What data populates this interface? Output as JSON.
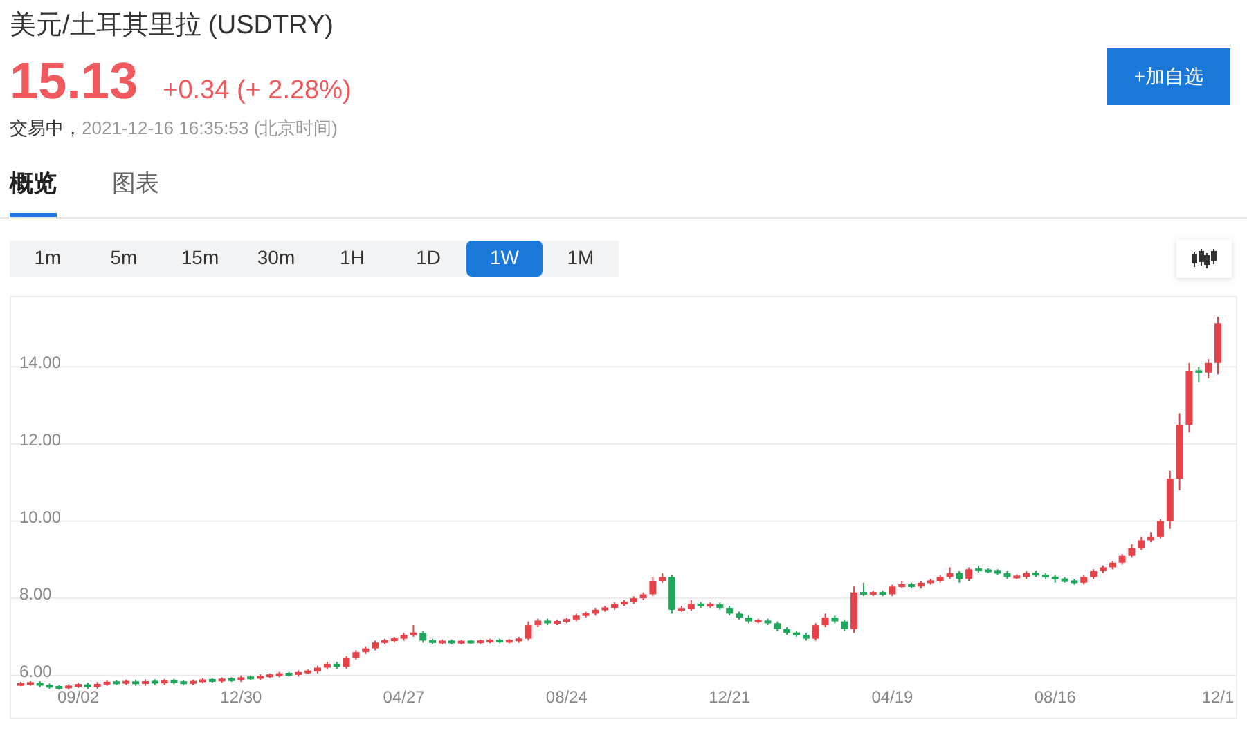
{
  "header": {
    "title": "美元/土耳其里拉 (USDTRY)",
    "price": "15.13",
    "change": "+0.34 (+ 2.28%)",
    "status": "交易中，",
    "timestamp": "2021-12-16 16:35:53 (北京时间)",
    "watch_button": "+加自选"
  },
  "tabs": [
    {
      "label": "概览",
      "selected": true
    },
    {
      "label": "图表",
      "selected": false
    }
  ],
  "intervals": [
    {
      "label": "1m",
      "selected": false
    },
    {
      "label": "5m",
      "selected": false
    },
    {
      "label": "15m",
      "selected": false
    },
    {
      "label": "30m",
      "selected": false
    },
    {
      "label": "1H",
      "selected": false
    },
    {
      "label": "1D",
      "selected": false
    },
    {
      "label": "1W",
      "selected": true
    },
    {
      "label": "1M",
      "selected": false
    }
  ],
  "chart": {
    "chart_data": {
      "type": "candlestick",
      "grid": true,
      "ylim": [
        4.9,
        15.8
      ],
      "yticks": [
        {
          "value": 6,
          "label": "6.00"
        },
        {
          "value": 8,
          "label": "8.00"
        },
        {
          "value": 10,
          "label": "10.00"
        },
        {
          "value": 12,
          "label": "12.00"
        },
        {
          "value": 14,
          "label": "14.00"
        }
      ],
      "categories": [
        null,
        null,
        null,
        null,
        null,
        null,
        "09/02",
        null,
        null,
        null,
        null,
        null,
        null,
        null,
        null,
        null,
        null,
        null,
        null,
        null,
        null,
        null,
        null,
        "12/30",
        null,
        null,
        null,
        null,
        null,
        null,
        null,
        null,
        null,
        null,
        null,
        null,
        null,
        null,
        null,
        null,
        "04/27",
        null,
        null,
        null,
        null,
        null,
        null,
        null,
        null,
        null,
        null,
        null,
        null,
        null,
        null,
        null,
        null,
        "08/24",
        null,
        null,
        null,
        null,
        null,
        null,
        null,
        null,
        null,
        null,
        null,
        null,
        null,
        null,
        null,
        null,
        "12/21",
        null,
        null,
        null,
        null,
        null,
        null,
        null,
        null,
        null,
        null,
        null,
        null,
        null,
        null,
        null,
        null,
        "04/19",
        null,
        null,
        null,
        null,
        null,
        null,
        null,
        null,
        null,
        null,
        null,
        null,
        null,
        null,
        null,
        null,
        "08/16",
        null,
        null,
        null,
        null,
        null,
        null,
        null,
        null,
        null,
        null,
        null,
        null,
        null,
        null,
        null,
        null,
        "12/1"
      ],
      "ohlc": [
        [
          5.75,
          5.83,
          5.72,
          5.78
        ],
        [
          5.78,
          5.85,
          5.73,
          5.8
        ],
        [
          5.8,
          5.85,
          5.69,
          5.74
        ],
        [
          5.74,
          5.79,
          5.65,
          5.7
        ],
        [
          5.7,
          5.75,
          5.63,
          5.68
        ],
        [
          5.68,
          5.77,
          5.63,
          5.72
        ],
        [
          5.72,
          5.81,
          5.67,
          5.76
        ],
        [
          5.76,
          5.81,
          5.65,
          5.7
        ],
        [
          5.7,
          5.83,
          5.65,
          5.78
        ],
        [
          5.78,
          5.87,
          5.73,
          5.82
        ],
        [
          5.82,
          5.87,
          5.75,
          5.8
        ],
        [
          5.8,
          5.89,
          5.75,
          5.84
        ],
        [
          5.84,
          5.89,
          5.73,
          5.78
        ],
        [
          5.78,
          5.9,
          5.73,
          5.85
        ],
        [
          5.85,
          5.9,
          5.75,
          5.8
        ],
        [
          5.8,
          5.91,
          5.75,
          5.86
        ],
        [
          5.86,
          5.91,
          5.77,
          5.82
        ],
        [
          5.82,
          5.87,
          5.75,
          5.8
        ],
        [
          5.8,
          5.89,
          5.75,
          5.84
        ],
        [
          5.84,
          5.93,
          5.79,
          5.88
        ],
        [
          5.88,
          5.93,
          5.81,
          5.86
        ],
        [
          5.86,
          5.95,
          5.81,
          5.9
        ],
        [
          5.9,
          5.95,
          5.83,
          5.88
        ],
        [
          5.88,
          6.0,
          5.83,
          5.95
        ],
        [
          5.95,
          6.0,
          5.87,
          5.92
        ],
        [
          5.92,
          6.03,
          5.87,
          5.98
        ],
        [
          5.98,
          6.05,
          5.93,
          6.0
        ],
        [
          6.0,
          6.09,
          5.95,
          6.04
        ],
        [
          6.04,
          6.09,
          5.97,
          6.02
        ],
        [
          6.02,
          6.13,
          5.97,
          6.08
        ],
        [
          6.08,
          6.15,
          6.03,
          6.1
        ],
        [
          6.1,
          6.25,
          6.05,
          6.2
        ],
        [
          6.2,
          6.35,
          6.15,
          6.3
        ],
        [
          6.3,
          6.35,
          6.17,
          6.22
        ],
        [
          6.22,
          6.5,
          6.17,
          6.45
        ],
        [
          6.45,
          6.65,
          6.4,
          6.6
        ],
        [
          6.6,
          6.75,
          6.55,
          6.7
        ],
        [
          6.7,
          6.9,
          6.65,
          6.85
        ],
        [
          6.85,
          6.95,
          6.8,
          6.9
        ],
        [
          6.9,
          7.0,
          6.85,
          6.95
        ],
        [
          6.95,
          7.1,
          6.9,
          7.05
        ],
        [
          7.05,
          7.3,
          7.0,
          7.1
        ],
        [
          7.1,
          7.15,
          6.85,
          6.9
        ],
        [
          6.9,
          6.95,
          6.8,
          6.85
        ],
        [
          6.85,
          6.93,
          6.8,
          6.88
        ],
        [
          6.88,
          6.93,
          6.8,
          6.85
        ],
        [
          6.85,
          6.92,
          6.8,
          6.87
        ],
        [
          6.87,
          6.92,
          6.81,
          6.86
        ],
        [
          6.86,
          6.93,
          6.81,
          6.88
        ],
        [
          6.88,
          6.95,
          6.83,
          6.9
        ],
        [
          6.9,
          6.95,
          6.83,
          6.88
        ],
        [
          6.88,
          6.94,
          6.83,
          6.89
        ],
        [
          6.89,
          7.0,
          6.84,
          6.95
        ],
        [
          6.95,
          7.4,
          6.9,
          7.3
        ],
        [
          7.3,
          7.47,
          7.25,
          7.42
        ],
        [
          7.42,
          7.47,
          7.3,
          7.35
        ],
        [
          7.35,
          7.45,
          7.3,
          7.4
        ],
        [
          7.4,
          7.5,
          7.35,
          7.45
        ],
        [
          7.45,
          7.6,
          7.4,
          7.55
        ],
        [
          7.55,
          7.65,
          7.5,
          7.6
        ],
        [
          7.6,
          7.75,
          7.55,
          7.7
        ],
        [
          7.7,
          7.8,
          7.65,
          7.75
        ],
        [
          7.75,
          7.9,
          7.7,
          7.85
        ],
        [
          7.85,
          7.95,
          7.8,
          7.9
        ],
        [
          7.9,
          8.05,
          7.85,
          8.0
        ],
        [
          8.0,
          8.15,
          7.95,
          8.1
        ],
        [
          8.1,
          8.55,
          8.05,
          8.45
        ],
        [
          8.45,
          8.65,
          8.4,
          8.55
        ],
        [
          8.55,
          8.6,
          7.6,
          7.7
        ],
        [
          7.7,
          7.8,
          7.65,
          7.72
        ],
        [
          7.72,
          7.95,
          7.67,
          7.85
        ],
        [
          7.85,
          7.9,
          7.75,
          7.8
        ],
        [
          7.8,
          7.89,
          7.75,
          7.84
        ],
        [
          7.84,
          7.89,
          7.7,
          7.75
        ],
        [
          7.75,
          7.8,
          7.55,
          7.6
        ],
        [
          7.6,
          7.65,
          7.45,
          7.5
        ],
        [
          7.5,
          7.55,
          7.35,
          7.4
        ],
        [
          7.4,
          7.47,
          7.35,
          7.42
        ],
        [
          7.42,
          7.47,
          7.3,
          7.35
        ],
        [
          7.35,
          7.4,
          7.15,
          7.2
        ],
        [
          7.2,
          7.25,
          7.05,
          7.1
        ],
        [
          7.1,
          7.15,
          7.0,
          7.05
        ],
        [
          7.05,
          7.1,
          6.9,
          6.95
        ],
        [
          6.95,
          7.35,
          6.9,
          7.3
        ],
        [
          7.3,
          7.6,
          7.25,
          7.5
        ],
        [
          7.5,
          7.55,
          7.35,
          7.4
        ],
        [
          7.4,
          7.45,
          7.15,
          7.2
        ],
        [
          7.2,
          8.3,
          7.1,
          8.15
        ],
        [
          8.15,
          8.4,
          8.05,
          8.1
        ],
        [
          8.1,
          8.2,
          8.05,
          8.15
        ],
        [
          8.15,
          8.2,
          8.05,
          8.1
        ],
        [
          8.1,
          8.35,
          8.05,
          8.3
        ],
        [
          8.3,
          8.45,
          8.25,
          8.35
        ],
        [
          8.35,
          8.4,
          8.25,
          8.3
        ],
        [
          8.3,
          8.45,
          8.25,
          8.4
        ],
        [
          8.4,
          8.5,
          8.35,
          8.45
        ],
        [
          8.45,
          8.6,
          8.4,
          8.55
        ],
        [
          8.55,
          8.8,
          8.5,
          8.65
        ],
        [
          8.65,
          8.7,
          8.4,
          8.5
        ],
        [
          8.5,
          8.8,
          8.45,
          8.75
        ],
        [
          8.75,
          8.85,
          8.67,
          8.72
        ],
        [
          8.72,
          8.77,
          8.65,
          8.7
        ],
        [
          8.7,
          8.75,
          8.6,
          8.65
        ],
        [
          8.65,
          8.7,
          8.5,
          8.55
        ],
        [
          8.55,
          8.62,
          8.5,
          8.55
        ],
        [
          8.55,
          8.7,
          8.5,
          8.65
        ],
        [
          8.65,
          8.7,
          8.55,
          8.6
        ],
        [
          8.6,
          8.65,
          8.5,
          8.55
        ],
        [
          8.55,
          8.6,
          8.4,
          8.5
        ],
        [
          8.5,
          8.55,
          8.4,
          8.45
        ],
        [
          8.45,
          8.5,
          8.35,
          8.4
        ],
        [
          8.4,
          8.6,
          8.35,
          8.55
        ],
        [
          8.55,
          8.75,
          8.5,
          8.7
        ],
        [
          8.7,
          8.85,
          8.65,
          8.8
        ],
        [
          8.8,
          8.97,
          8.75,
          8.92
        ],
        [
          8.92,
          9.15,
          8.87,
          9.1
        ],
        [
          9.1,
          9.4,
          9.05,
          9.3
        ],
        [
          9.3,
          9.6,
          9.25,
          9.5
        ],
        [
          9.5,
          9.7,
          9.45,
          9.6
        ],
        [
          9.6,
          10.05,
          9.55,
          10.0
        ],
        [
          10.0,
          11.3,
          9.8,
          11.1
        ],
        [
          11.1,
          12.8,
          10.8,
          12.5
        ],
        [
          12.5,
          14.1,
          12.3,
          13.9
        ],
        [
          13.9,
          14.0,
          13.6,
          13.85
        ],
        [
          13.85,
          14.2,
          13.7,
          14.1
        ],
        [
          14.1,
          15.3,
          13.8,
          15.13
        ]
      ]
    }
  }
}
